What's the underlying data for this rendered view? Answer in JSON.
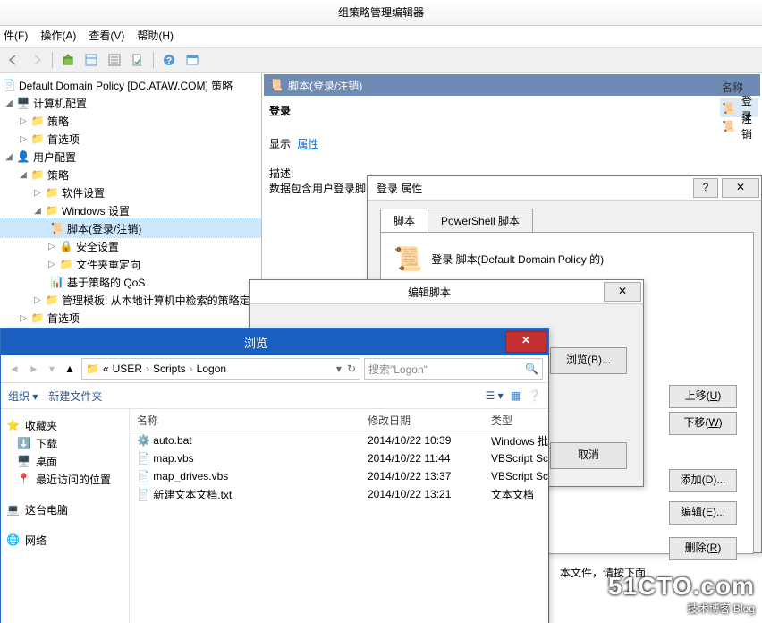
{
  "app_title": "组策略管理编辑器",
  "menubar": {
    "file": "件(F)",
    "action": "操作(A)",
    "view": "查看(V)",
    "help": "帮助(H)"
  },
  "tree": {
    "root": "Default Domain Policy [DC.ATAW.COM] 策略",
    "computer_config": "计算机配置",
    "computer_policies": "策略",
    "computer_prefs": "首选项",
    "user_config": "用户配置",
    "user_policies": "策略",
    "soft_settings": "软件设置",
    "windows_settings": "Windows 设置",
    "scripts": "脚本(登录/注销)",
    "security": "安全设置",
    "folder_redir": "文件夹重定向",
    "policy_qos": "基于策略的 QoS",
    "admin_templates": "管理模板: 从本地计算机中检索的策略定",
    "user_prefs": "首选项"
  },
  "detail": {
    "header": "脚本(登录/注销)",
    "title": "登录",
    "show_label": "显示",
    "show_link": "属性",
    "desc_label": "描述:",
    "desc_text": "数据包含用户登录脚",
    "col_name": "名称",
    "row_login": "登录",
    "row_logoff": "注销"
  },
  "props": {
    "title": "登录 属性",
    "tab_script": "脚本",
    "tab_ps": "PowerShell 脚本",
    "caption": "登录 脚本(Default Domain Policy 的)",
    "btn_up": "上移(U)",
    "btn_down": "下移(W)",
    "btn_add": "添加(D)...",
    "btn_edit": "编辑(E)...",
    "btn_del": "删除(R)",
    "note": "本文件，请按下面"
  },
  "edit": {
    "title": "编辑脚本",
    "btn_browse": "浏览(B)...",
    "btn_cancel": "取消"
  },
  "browse": {
    "title": "浏览",
    "crumb_user": "USER",
    "crumb_scripts": "Scripts",
    "crumb_logon": "Logon",
    "search_ph": "搜索\"Logon\"",
    "org": "组织",
    "newfolder": "新建文件夹",
    "fav": "收藏夹",
    "downloads": "下载",
    "desktop": "桌面",
    "recent": "最近访问的位置",
    "thispc": "这台电脑",
    "network": "网络",
    "col_name": "名称",
    "col_date": "修改日期",
    "col_type": "类型",
    "files": [
      {
        "name": "auto.bat",
        "date": "2014/10/22 10:39",
        "type": "Windows 批"
      },
      {
        "name": "map.vbs",
        "date": "2014/10/22 11:44",
        "type": "VBScript Sc"
      },
      {
        "name": "map_drives.vbs",
        "date": "2014/10/22 13:37",
        "type": "VBScript Sc"
      },
      {
        "name": "新建文本文档.txt",
        "date": "2014/10/22 13:21",
        "type": "文本文档"
      }
    ]
  },
  "watermark": {
    "big": "51CTO.com",
    "small": "技术博客   Blog"
  }
}
